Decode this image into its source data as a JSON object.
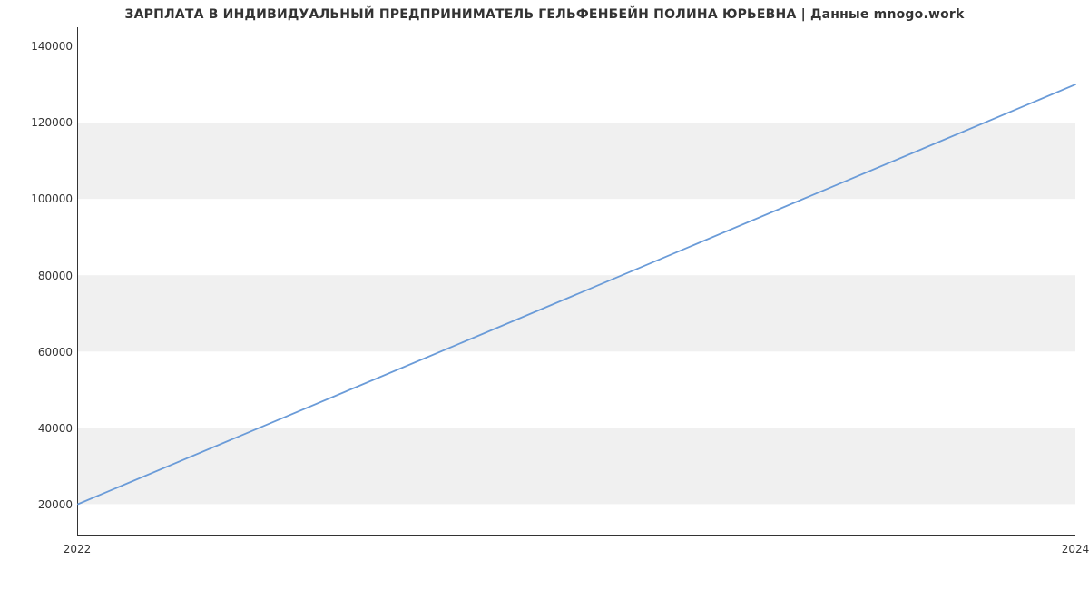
{
  "chart_data": {
    "type": "line",
    "title": "ЗАРПЛАТА В ИНДИВИДУАЛЬНЫЙ ПРЕДПРИНИМАТЕЛЬ ГЕЛЬФЕНБЕЙН ПОЛИНА ЮРЬЕВНА | Данные mnogo.work",
    "xlabel": "",
    "ylabel": "",
    "x_ticks": [
      "2022",
      "2024"
    ],
    "y_ticks": [
      20000,
      40000,
      60000,
      80000,
      100000,
      120000,
      140000
    ],
    "ylim": [
      12000,
      145000
    ],
    "xlim_years": [
      2022,
      2024
    ],
    "series": [
      {
        "name": "salary",
        "x": [
          2022,
          2024
        ],
        "y": [
          20000,
          130000
        ]
      }
    ],
    "line_color": "#6a9bd8",
    "band_color": "#f0f0f0"
  }
}
